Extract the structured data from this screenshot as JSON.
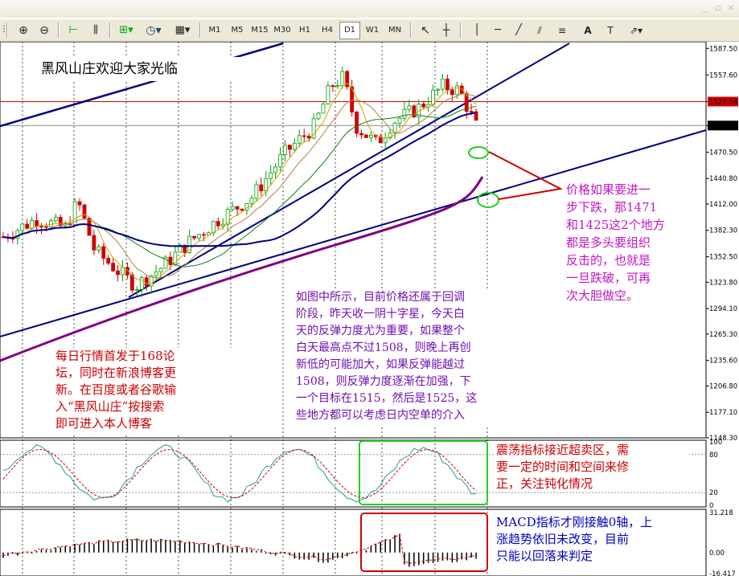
{
  "toolbar": {
    "timeframes": [
      "M1",
      "M5",
      "M15",
      "M30",
      "H1",
      "H4",
      "D1",
      "W1",
      "MN"
    ],
    "active_timeframe": "D1"
  },
  "price_axis": {
    "labels": [
      "1587.50",
      "1557.60",
      "1527.54",
      "1500.50",
      "1470.50",
      "1440.80",
      "1412.00",
      "1382.30",
      "1352.50",
      "1323.80",
      "1294.10",
      "1265.30",
      "1235.60",
      "1206.80",
      "1177.10",
      "1148.30"
    ],
    "current_price": "1500.50",
    "red_line_price": "1527.54"
  },
  "oscillator_axis": {
    "labels": [
      "100",
      "80",
      "20",
      "0"
    ]
  },
  "macd_axis": {
    "labels": [
      "31.218",
      "0.00",
      "-16.417"
    ]
  },
  "notes": {
    "title": "黑风山庄欢迎大家光临",
    "daily": [
      "每日行情首发于168论",
      "坛，同时在新浪博客更",
      "新。在百度或者谷歌输",
      "入“黑风山庄”按搜索",
      "即可进入本人博客"
    ],
    "main": [
      "如图中所示，目前价格还属于回调",
      "阶段，昨天收一阴十字星，今天白",
      "天的反弹力度尤为重要，如果整个",
      "白天最高点不过1508，则晚上再创",
      "新低的可能加大，如果反弹能越过",
      "1508，则反弹力度逐渐在加强，下",
      "一个目标在1515，然后是1525，这",
      "些地方都可以考虑日内空单的介入"
    ],
    "price": [
      "价格如果要进一",
      "步下跌，那1471",
      "和1425这2个地方",
      "都是多头要组织",
      "反击的，也就是",
      "一旦跌破，可再",
      "次大胆做空。"
    ],
    "oscillator": [
      "震荡指标接近超卖区，需",
      "要一定的时间和空间来修",
      "正，关注钝化情况"
    ],
    "macd": [
      "MACD指标才刚接触0轴，上",
      "涨趋势依旧未改变，目前",
      "只能以回落来判定"
    ]
  },
  "chart_data": {
    "type": "candlestick",
    "price_range": [
      1148.3,
      1595
    ],
    "current_price": 1500.5,
    "resistance_level": 1527.54,
    "support_targets": [
      1471,
      1425
    ],
    "oscillator_range": [
      0,
      100
    ],
    "oscillator_levels": [
      80,
      20
    ],
    "macd_range": [
      -16.417,
      31.218
    ],
    "colors": {
      "bull": "#00a000",
      "bear": "#d00000",
      "ma_slow": "#800080",
      "trend": "#000080",
      "resistance": "#d00000"
    }
  }
}
